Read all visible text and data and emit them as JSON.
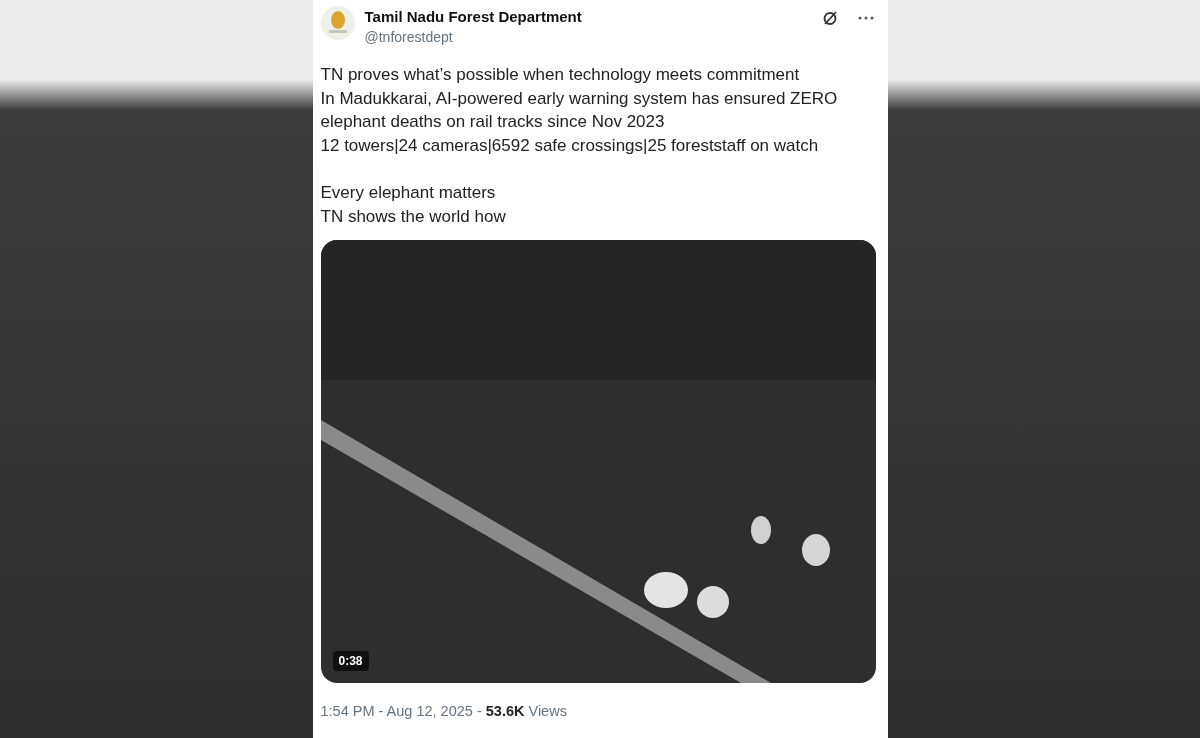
{
  "post": {
    "author": "Tamil Nadu Forest Department",
    "handle": "@tnforestdept",
    "paragraphs": [
      [
        "TN proves what’s possible when technology meets commitment",
        "In Madukkarai, AI-powered early warning system has ensured ZERO elephant deaths on rail tracks since Nov 2023",
        "12 towers|24 cameras|6592 safe crossings|25 foreststaff on watch"
      ],
      [
        "Every elephant matters",
        "TN shows the world how"
      ]
    ],
    "video": {
      "duration": "0:38"
    },
    "footer": "1:54 PM - Aug 12, 2025 - **53.6K** Views"
  }
}
